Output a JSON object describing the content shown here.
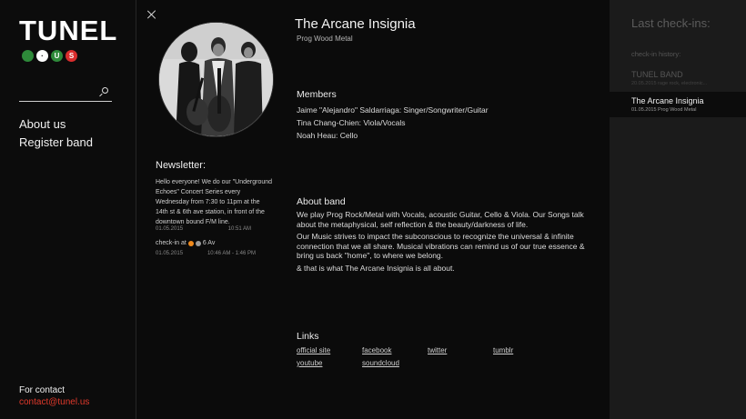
{
  "logo": {
    "text": "TUNEL",
    "dots": [
      {
        "glyph": "",
        "color": "#2e8a3a",
        "icon": "train-dot-icon"
      },
      {
        "glyph": "·",
        "color": "#ffffff",
        "icon": "white-dot-icon"
      },
      {
        "glyph": "U",
        "color": "#2e8a3a",
        "icon": "u-line-icon"
      },
      {
        "glyph": "S",
        "color": "#d92d2d",
        "icon": "s-line-icon"
      }
    ]
  },
  "search": {
    "placeholder": "",
    "icon": "search-icon"
  },
  "nav": {
    "about": "About us",
    "register": "Register band"
  },
  "contact": {
    "label": "For contact",
    "email": "contact@tunel.us"
  },
  "newsletter": {
    "title": "Newsletter:",
    "text": "Hello everyone! We do our \"Underground Echoes\" Concert Series every Wednesday from 7:30 to 11pm at the 14th st & 6th ave station, in front of the downtown bound F/M line.",
    "date": "01.05.2015",
    "time": "10:51 AM",
    "checkin_label": "check-in at",
    "checkin_station": "6 Av",
    "checkin_dot_colors": [
      "#f08a1c",
      "#9a9a9a"
    ],
    "checkin_date": "01.05.2015",
    "checkin_time": "10:46 AM - 1:46 PM"
  },
  "band": {
    "name": "The Arcane Insignia",
    "genre": "Prog Wood Metal",
    "members_title": "Members",
    "members": [
      "Jaime \"Alejandro\" Saldarriaga: Singer/Songwriter/Guitar",
      "Tina Chang-Chien: Viola/Vocals",
      "Noah Heau: Cello"
    ],
    "about_title": "About band",
    "about": [
      "We play Prog Rock/Metal with Vocals, acoustic Guitar, Cello & Viola. Our Songs talk about the metaphysical, self reflection & the beauty/darkness of life.",
      "Our Music strives to impact the subconscious to recognize the universal & infinite connection that we all share. Musical vibrations can remind us of our true essence & bring us back \"home\", to where we belong.",
      "& that is what The Arcane Insignia is all about."
    ],
    "links_title": "Links",
    "links": [
      "official site",
      "facebook",
      "twitter",
      "tumblr",
      "youtube",
      "soundcloud"
    ]
  },
  "checkins": {
    "title": "Last check-ins:",
    "history_label": "check-in history:",
    "items": [
      {
        "name": "TUNEL BAND",
        "meta": "20.05.2015  rage rock, electronic..."
      },
      {
        "name": "The Arcane Insignia",
        "meta": "01.05.2015  Prog Wood Metal"
      }
    ]
  }
}
